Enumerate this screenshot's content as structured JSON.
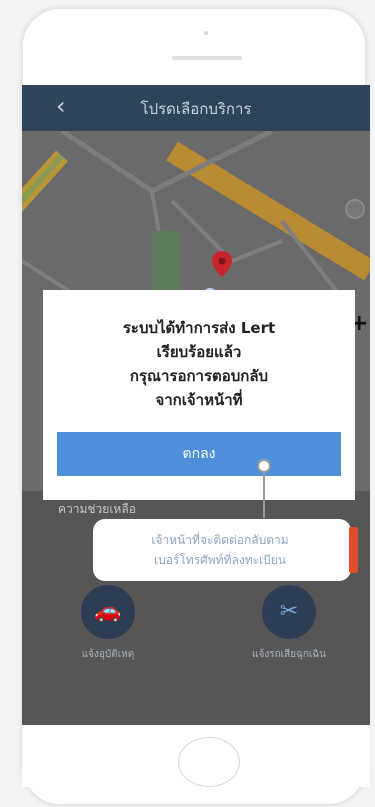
{
  "header": {
    "title": "โปรดเลือกบริการ",
    "back_icon": "chevron-left-icon"
  },
  "dialog": {
    "lines": [
      "ระบบได้ทำการส่ง Lert",
      "เรียบร้อยแล้ว",
      "กรุณารอการตอบกลับ",
      "จากเจ้าหน้าที่"
    ],
    "ok_label": "ตกลง"
  },
  "under_dialog_text": "ความช่วยเหลือ",
  "callout": {
    "line1": "เจ้าหน้าที่จะติดต่อกลับตาม",
    "line2": "เบอร์โทรศัพท์ที่ลงทะเบียน"
  },
  "services": [
    {
      "label": "แจ้งอุบัติเหตุ",
      "icon": "car-crash-icon"
    },
    {
      "label": "แจ้งรถเสียฉุกเฉิน",
      "icon": "car-repair-icon"
    }
  ],
  "colors": {
    "header_bg": "#2e4459",
    "button_bg": "#4d8fd9",
    "accent": "#e24e2a",
    "pin": "#c8262c"
  }
}
